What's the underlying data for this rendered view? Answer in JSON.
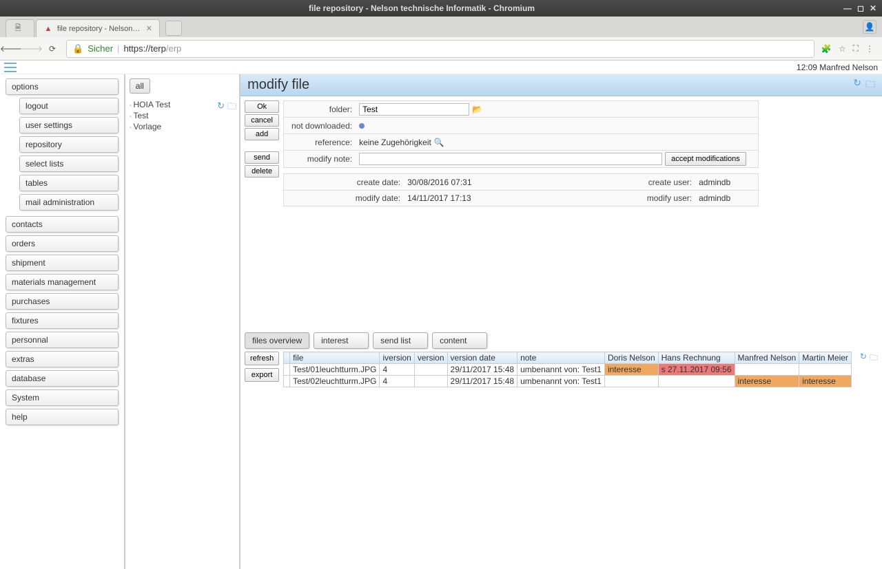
{
  "window": {
    "title": "file repository - Nelson technische Informatik - Chromium"
  },
  "tabs": [
    {
      "label": ""
    },
    {
      "label": "file repository - Nelson te"
    }
  ],
  "url": {
    "secure": "Sicher",
    "protocol": "https://",
    "host": "terp",
    "path": "/erp"
  },
  "topbar": {
    "time": "12:09",
    "user": "Manfred Nelson"
  },
  "sidebar": {
    "options_label": "options",
    "options_sub": [
      "logout",
      "user settings",
      "repository",
      "select lists",
      "tables",
      "mail administration"
    ],
    "items": [
      "contacts",
      "orders",
      "shipment",
      "materials management",
      "purchases",
      "fixtures",
      "personnal",
      "extras",
      "database",
      "System",
      "help"
    ]
  },
  "tree": {
    "all_label": "all",
    "items": [
      "HOIA Test",
      "Test",
      "Vorlage"
    ]
  },
  "content": {
    "header": "modify file",
    "buttons": {
      "ok": "Ok",
      "cancel": "cancel",
      "add": "add",
      "send": "send",
      "delete": "delete"
    },
    "fields": {
      "folder_label": "folder:",
      "folder_value": "Test",
      "notdl_label": "not downloaded:",
      "ref_label": "reference:",
      "ref_value": "keine Zugehörigkeit",
      "modnote_label": "modify note:",
      "accept_label": "accept modifications",
      "created_label": "create date:",
      "created_value": "30/08/2016 07:31",
      "createuser_label": "create user:",
      "createuser_value": "admindb",
      "modified_label": "modify date:",
      "modified_value": "14/11/2017 17:13",
      "modifyuser_label": "modify user:",
      "modifyuser_value": "admindb"
    }
  },
  "lower": {
    "tabs": [
      "files overview",
      "interest",
      "send list",
      "content"
    ],
    "buttons": {
      "refresh": "refresh",
      "export": "export"
    },
    "columns": [
      "",
      "file",
      "iversion",
      "version",
      "version date",
      "note",
      "Doris Nelson",
      "Hans Rechnung",
      "Manfred Nelson",
      "Martin Meier"
    ],
    "rows": [
      {
        "file": "Test/01leuchtturm.JPG",
        "iversion": "4",
        "version": "",
        "vdate": "29/11/2017 15:48",
        "note": "umbenannt von: Test1",
        "c1": "interesse",
        "c2": "s 27.11.2017 09:56",
        "c3": "",
        "c4": ""
      },
      {
        "file": "Test/02leuchtturm.JPG",
        "iversion": "4",
        "version": "",
        "vdate": "29/11/2017 15:48",
        "note": "umbenannt von: Test1",
        "c1": "",
        "c2": "",
        "c3": "interesse",
        "c4": "interesse"
      }
    ]
  }
}
